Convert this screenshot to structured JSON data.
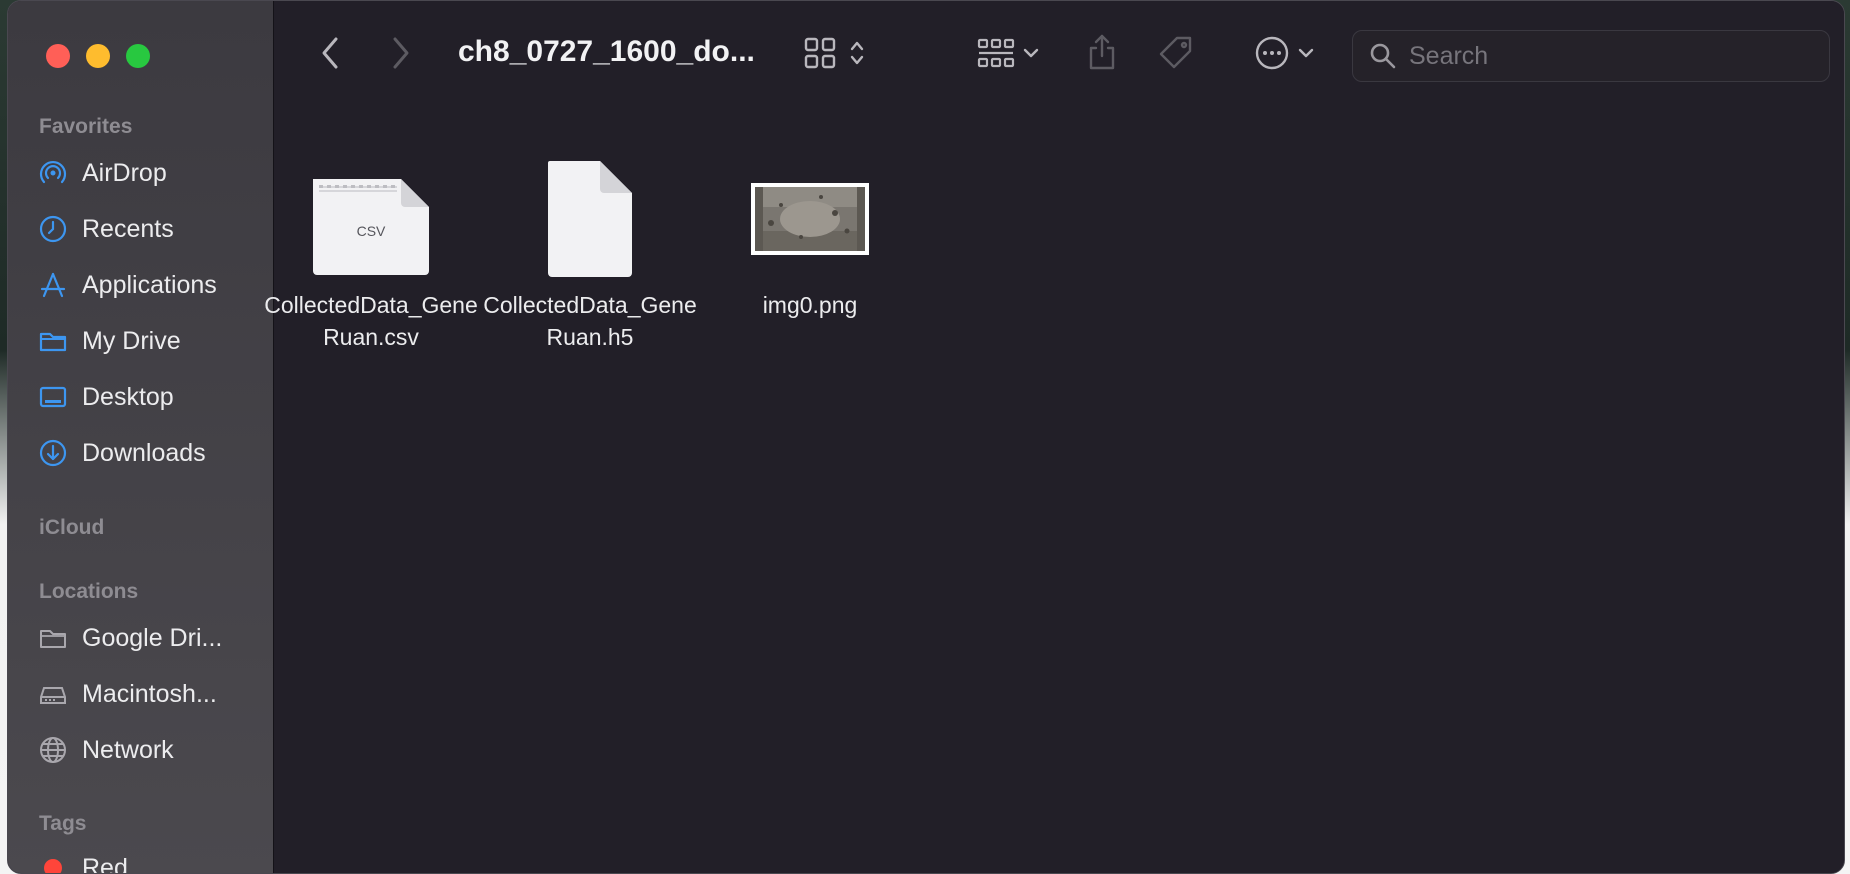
{
  "window": {
    "title": "ch8_0727_1600_do..."
  },
  "sidebar": {
    "favorites_heading": "Favorites",
    "favorites": [
      {
        "label": "AirDrop",
        "icon": "airdrop-icon"
      },
      {
        "label": "Recents",
        "icon": "clock-icon"
      },
      {
        "label": "Applications",
        "icon": "applications-icon"
      },
      {
        "label": "My Drive",
        "icon": "folder-icon"
      },
      {
        "label": "Desktop",
        "icon": "desktop-icon"
      },
      {
        "label": "Downloads",
        "icon": "download-icon"
      }
    ],
    "icloud_heading": "iCloud",
    "locations_heading": "Locations",
    "locations": [
      {
        "label": "Google Dri...",
        "icon": "folder-icon"
      },
      {
        "label": "Macintosh...",
        "icon": "hard-drive-icon"
      },
      {
        "label": "Network",
        "icon": "globe-icon"
      }
    ],
    "tags_heading": "Tags",
    "tags": [
      {
        "label": "Red",
        "color": "#ff453a"
      }
    ]
  },
  "toolbar": {
    "back": "back-icon",
    "forward": "forward-icon",
    "view_mode": "grid-view-icon",
    "group": "group-icon",
    "share": "share-icon",
    "tag": "tag-icon",
    "more": "more-icon",
    "search_placeholder": "Search"
  },
  "files": [
    {
      "name": "CollectedData_GeneRuan.csv",
      "kind": "csv",
      "badge": "CSV"
    },
    {
      "name": "CollectedData_GeneRuan.h5",
      "kind": "generic"
    },
    {
      "name": "img0.png",
      "kind": "image"
    }
  ],
  "colors": {
    "accent": "#3d96f0",
    "window_bg": "#221f28",
    "sidebar_bg": "#3f3d43"
  }
}
